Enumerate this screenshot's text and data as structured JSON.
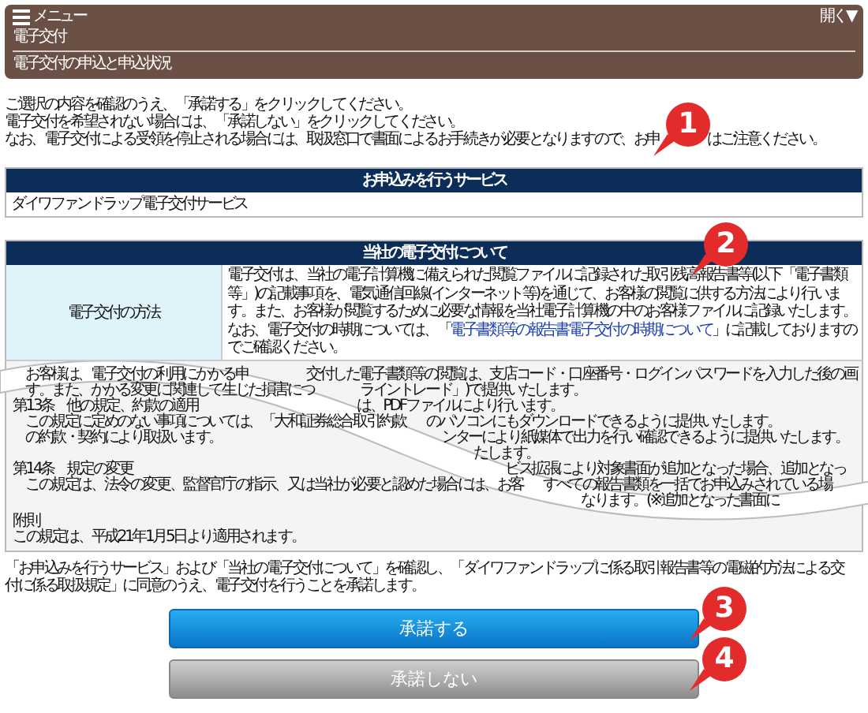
{
  "menu": {
    "label": "メニュー",
    "toggle": "開く▼",
    "title": "電子交付",
    "subtitle": "電子交付の申込と申込状況"
  },
  "intro": [
    "ご選択の内容を確認のうえ、「承諾する」をクリックしてください。",
    "電子交付を希望されない場合には、「承諾しない」をクリックしてください。"
  ],
  "intro_last": {
    "before": "なお、電子交付による受領を停止される場合には、取扱窓口で書面によるお手続きが必要となりますので、お申",
    "after": "はご注意ください。"
  },
  "service": {
    "header": "お申込みを行うサービス",
    "value": "ダイワファンドラップ電子交付サービス"
  },
  "about": {
    "header": "当社の電子交付について",
    "label": "電子交付の方法",
    "text_before": "電子交付は、当社の電子計算機に備えられた閲覧ファイルに記録された取引残高報告書等(以下「電子書類等」)の記載事項を、電気通信回線(インターネット等)を通じて、お客様の閲覧に供する方法により行います。また、お客様が閲覧するために必要な情報を当社電子計算機の中のお客様ファイルに記録いたします。なお、電子交付の時期については、「",
    "link": "電子書類等の報告書電子交付の時期について",
    "text_after": "」に記載しておりますのでご確認ください。"
  },
  "terms": [
    {
      "kind": "body",
      "left": "お客様は、電子交付の利用にかかる申",
      "right": "交付した電子書類等の閲覧は、支店コード・口座番号・ログインパスワードを入力した後の画"
    },
    {
      "kind": "body",
      "left": "す。また、かかる変更に関連して生じた損害につ",
      "right": "ライントレード」)で提供いたします。"
    },
    {
      "kind": "heading",
      "left": "第13条　他の規定、約款の適用",
      "right": "は、PDFファイルにより行います。"
    },
    {
      "kind": "body",
      "left": "この規定に定めのない事項については、「大和証券総合取引約款",
      "right": "のパソコンにもダウンロードできるように提供いたします。"
    },
    {
      "kind": "body",
      "left": "の約款・契約により取扱います。",
      "right": "ンターにより紙媒体で出力を行い確認できるように提供いたします。"
    },
    {
      "right": "たします。"
    },
    {
      "kind": "heading",
      "left": "第14条　規定の変更",
      "right": "ビス拡張により対象書面が追加となった場合、追加となっ"
    },
    {
      "kind": "body",
      "left": "この規定は、法令の変更、監督官庁の指示、又は当社が必要と認めた場合には、お客",
      "right": "すべての報告書類を一括でお申込みされている場"
    },
    {
      "right": "なります。(※追加となった書面に"
    }
  ],
  "appendix": {
    "title": "附則",
    "text": "この規定は、平成21年1月5日より適用されます。"
  },
  "agreement": "「お申込みを行うサービス」および「当社の電子交付について」を確認し、「ダイワファンドラップに係る取引報告書等の電磁的方法による交付に係る取扱規定」に同意のうえ、電子交付を行うことを承諾します。",
  "buttons": [
    {
      "label": "承諾する",
      "kind": "primary"
    },
    {
      "label": "承諾しない",
      "kind": "secondary"
    }
  ],
  "callouts": [
    "1",
    "2",
    "3",
    "4"
  ]
}
